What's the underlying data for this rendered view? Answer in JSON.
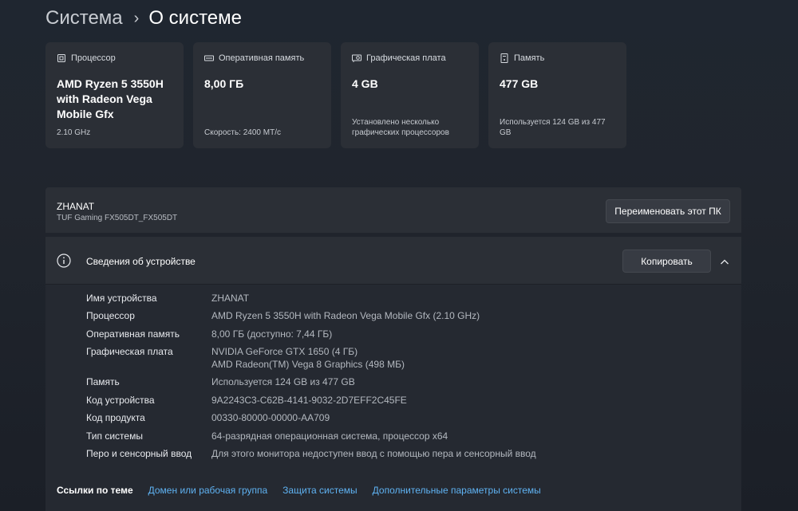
{
  "breadcrumb": {
    "parent": "Система",
    "separator": "›",
    "current": "О системе"
  },
  "cards": [
    {
      "icon": "processor-icon",
      "title": "Процессор",
      "value": "AMD Ryzen 5 3550H with Radeon Vega Mobile Gfx",
      "note": "2.10 GHz"
    },
    {
      "icon": "ram-icon",
      "title": "Оперативная память",
      "value": "8,00 ГБ",
      "note": "Скорость: 2400 МТ/с"
    },
    {
      "icon": "graphics-card-icon",
      "title": "Графическая плата",
      "value": "4 GB",
      "note": "Установлено несколько графических процессоров"
    },
    {
      "icon": "storage-icon",
      "title": "Память",
      "value": "477 GB",
      "note": "Используется 124 GB из 477 GB"
    }
  ],
  "device": {
    "name": "ZHANAT",
    "model": "TUF Gaming FX505DT_FX505DT",
    "rename_label": "Переименовать этот ПК"
  },
  "specs": {
    "title": "Сведения об устройстве",
    "copy_label": "Копировать",
    "rows": [
      {
        "label": "Имя устройства",
        "value": "ZHANAT"
      },
      {
        "label": "Процессор",
        "value": "AMD Ryzen 5 3550H with Radeon Vega Mobile Gfx (2.10 GHz)"
      },
      {
        "label": "Оперативная память",
        "value": "8,00 ГБ (доступно: 7,44 ГБ)"
      },
      {
        "label": "Графическая плата",
        "value": "NVIDIA GeForce GTX 1650 (4 ГБ)",
        "value2": "AMD Radeon(TM) Vega 8 Graphics (498 МБ)"
      },
      {
        "label": "Память",
        "value": "Используется 124 GB из 477 GB"
      },
      {
        "label": "Код устройства",
        "value": "9A2243C3-C62B-4141-9032-2D7EFF2C45FE"
      },
      {
        "label": "Код продукта",
        "value": "00330-80000-00000-AA709"
      },
      {
        "label": "Тип системы",
        "value": "64-разрядная операционная система, процессор x64"
      },
      {
        "label": "Перо и сенсорный ввод",
        "value": "Для этого монитора недоступен ввод с помощью пера и сенсорный ввод"
      }
    ]
  },
  "related": {
    "title": "Ссылки по теме",
    "links": [
      "Домен или рабочая группа",
      "Защита системы",
      "Дополнительные параметры системы"
    ]
  },
  "colors": {
    "accent_link": "#5fb2f2",
    "card_bg": "#2b2f36",
    "page_bg": "#20252d"
  }
}
